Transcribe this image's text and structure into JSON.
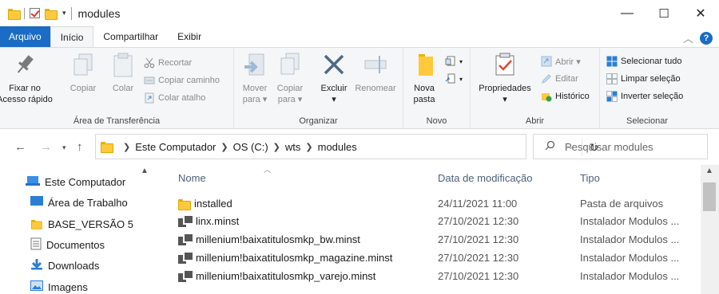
{
  "window": {
    "title": "modules",
    "controls": {
      "minimize": "—",
      "maximize": "☐",
      "close": "✕"
    }
  },
  "tabs": [
    {
      "label": "Arquivo"
    },
    {
      "label": "Início"
    },
    {
      "label": "Compartilhar"
    },
    {
      "label": "Exibir"
    }
  ],
  "ribbon": {
    "clipboard": {
      "label": "Área de Transferência",
      "pin": "Fixar no\nAcesso rápido",
      "copy": "Copiar",
      "paste": "Colar",
      "cut": "Recortar",
      "copy_path": "Copiar caminho",
      "paste_shortcut": "Colar atalho"
    },
    "organize": {
      "label": "Organizar",
      "move_to": "Mover\npara ▾",
      "copy_to": "Copiar\npara ▾",
      "delete": "Excluir\n▾",
      "rename": "Renomear"
    },
    "new": {
      "label": "Novo",
      "new_folder": "Nova\npasta"
    },
    "open": {
      "label": "Abrir",
      "properties": "Propriedades\n▾",
      "open": "Abrir ▾",
      "edit": "Editar",
      "history": "Histórico"
    },
    "select": {
      "label": "Selecionar",
      "select_all": "Selecionar tudo",
      "select_none": "Limpar seleção",
      "invert": "Inverter seleção"
    }
  },
  "address": {
    "crumbs": [
      "Este Computador",
      "OS (C:)",
      "wts",
      "modules"
    ],
    "search_placeholder": "Pesquisar modules"
  },
  "sidebar": {
    "items": [
      {
        "label": "Este Computador"
      },
      {
        "label": "Área de Trabalho"
      },
      {
        "label": "BASE_VERSÃO 5"
      },
      {
        "label": "Documentos"
      },
      {
        "label": "Downloads"
      },
      {
        "label": "Imagens"
      }
    ]
  },
  "columns": {
    "name": "Nome",
    "date": "Data de modificação",
    "type": "Tipo"
  },
  "files": [
    {
      "name": "installed",
      "date": "24/11/2021 11:00",
      "type": "Pasta de arquivos",
      "icon": "folder-icon"
    },
    {
      "name": "linx.minst",
      "date": "27/10/2021 12:30",
      "type": "Instalador Modulos ...",
      "icon": "file-icon"
    },
    {
      "name": "millenium!baixatitulosmkp_bw.minst",
      "date": "27/10/2021 12:30",
      "type": "Instalador Modulos ...",
      "icon": "file-icon"
    },
    {
      "name": "millenium!baixatitulosmkp_magazine.minst",
      "date": "27/10/2021 12:30",
      "type": "Instalador Modulos ...",
      "icon": "file-icon"
    },
    {
      "name": "millenium!baixatitulosmkp_varejo.minst",
      "date": "27/10/2021 12:30",
      "type": "Instalador Modulos ...",
      "icon": "file-icon"
    }
  ],
  "colors": {
    "accent": "#1a6cc4",
    "folder": "#ffc93c",
    "column_header": "#4c607a"
  }
}
